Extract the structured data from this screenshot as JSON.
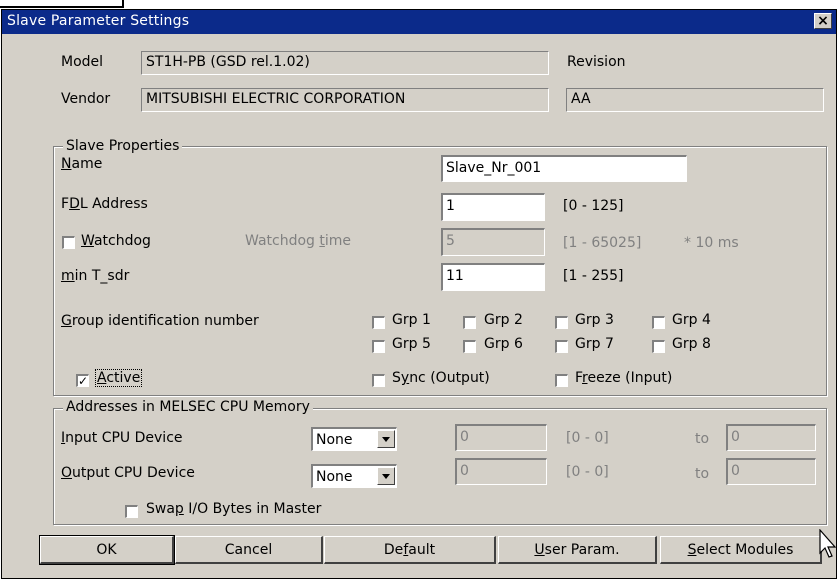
{
  "window": {
    "title": "Slave Parameter Settings",
    "close_label": "×"
  },
  "device": {
    "model_label": "Model",
    "model_value": "ST1H-PB (GSD rel.1.02)",
    "vendor_label": "Vendor",
    "vendor_value": "MITSUBISHI ELECTRIC CORPORATION",
    "revision_label": "Revision",
    "revision_value": "AA"
  },
  "slave_properties": {
    "legend": "Slave Properties",
    "name_label_u": "N",
    "name_label_rest": "ame",
    "name_value": "Slave_Nr_001",
    "fdl_label_a": "F",
    "fdl_label_u": "D",
    "fdl_label_b": "L Address",
    "fdl_value": "1",
    "fdl_range": "[0 - 125]",
    "watchdog_label_u": "W",
    "watchdog_label_rest": "atchdog",
    "watchdog_checked": false,
    "watchdog_time_label_a": "Watchdog ",
    "watchdog_time_label_u": "t",
    "watchdog_time_label_b": "ime",
    "watchdog_time_value": "5",
    "watchdog_time_range": "[1 - 65025]",
    "watchdog_time_unit": "* 10 ms",
    "tsdr_label_u": "m",
    "tsdr_label_rest": "in T_sdr",
    "tsdr_value": "11",
    "tsdr_range": "[1 - 255]",
    "group_label_u": "G",
    "group_label_rest": "roup identification number",
    "groups": [
      "Grp 1",
      "Grp 2",
      "Grp 3",
      "Grp 4",
      "Grp 5",
      "Grp 6",
      "Grp 7",
      "Grp 8"
    ],
    "active_label_u": "A",
    "active_label_rest": "ctive",
    "active_checked": true,
    "sync_label_a": "S",
    "sync_label_u": "y",
    "sync_label_b": "nc (Output)",
    "freeze_label_a": "F",
    "freeze_label_u": "r",
    "freeze_label_b": "eeze (Input)"
  },
  "addresses": {
    "legend": "Addresses in MELSEC CPU Memory",
    "input_label_u": "I",
    "input_label_rest": "nput CPU Device",
    "input_device": "None",
    "input_value": "0",
    "input_range": "[0 - 0]",
    "input_to_label": "to",
    "input_to_value": "0",
    "output_label_u": "O",
    "output_label_rest": "utput CPU Device",
    "output_device": "None",
    "output_value": "0",
    "output_range": "[0 - 0]",
    "output_to_label": "to",
    "output_to_value": "0",
    "swap_label_a": "Swa",
    "swap_label_u": "p",
    "swap_label_b": " I/O Bytes in Master"
  },
  "buttons": {
    "ok": "OK",
    "cancel": "Cancel",
    "default_a": "De",
    "default_u": "f",
    "default_b": "ault",
    "user_u": "U",
    "user_rest": "ser Param.",
    "select_u": "S",
    "select_rest": "elect Modules"
  },
  "colors": {
    "titlebar": "#0b2a8a",
    "face": "#d4d0c8"
  }
}
